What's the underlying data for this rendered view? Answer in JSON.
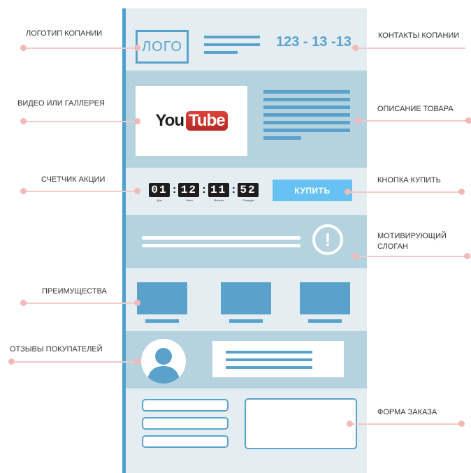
{
  "mockup": {
    "logo": "ЛОГО",
    "phone": "123 - 13 -13",
    "video_brand_you": "You",
    "video_brand_tube": "Tube",
    "timer": [
      {
        "digits": "01",
        "caption": "Дни"
      },
      {
        "digits": "12",
        "caption": "Часы"
      },
      {
        "digits": "11",
        "caption": "Минуты"
      },
      {
        "digits": "52",
        "caption": "Секунды"
      }
    ],
    "buy_button": "КУПИТЬ",
    "slogan_mark": "!"
  },
  "labels": {
    "logo": "ЛОГОТИП КОПАНИИ",
    "video": "ВИДЕО ИЛИ ГАЛЛЕРЕЯ",
    "counter": "СЧЕТЧИК АКЦИИ",
    "advantages": "ПРЕИМУЩЕСТВА",
    "reviews": "ОТЗЫВЫ ПОКУПАТЕЛЕЙ",
    "contacts": "КОНТАКТЫ КОПАНИИ",
    "description": "ОПИСАНИЕ ТОВАРА",
    "buy_button": "КНОПКА КУПИТЬ",
    "slogan_line1": "МОТИВИРУЮЩИЙ",
    "slogan_line2": "СЛОГАН",
    "order_form": "ФОРМА ЗАКАЗА"
  },
  "colors": {
    "accent_blue": "#5aa2cc",
    "button_blue": "#66c2f2",
    "section_dark": "#b5d3de",
    "section_light": "#e4eef2",
    "annotation_pink": "#f2b9b9"
  },
  "icons": [
    "youtube-logo",
    "exclamation-circle-icon",
    "user-silhouette-icon"
  ]
}
